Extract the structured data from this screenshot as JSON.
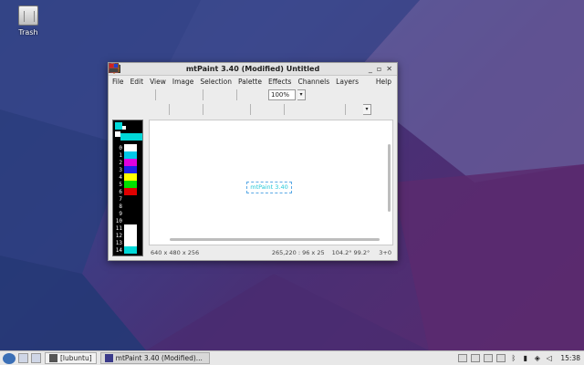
{
  "desktop": {
    "trash_label": "Trash"
  },
  "window": {
    "title": "mtPaint 3.40 (Modified) Untitled",
    "controls": [
      "_",
      "▫",
      "✕"
    ]
  },
  "menu": {
    "items": [
      "File",
      "Edit",
      "View",
      "Image",
      "Selection",
      "Palette",
      "Effects",
      "Channels",
      "Layers"
    ],
    "help": "Help"
  },
  "toolbar": {
    "zoom_value": "100%"
  },
  "palette": {
    "entries": [
      {
        "index": "0",
        "color": "#ffffff"
      },
      {
        "index": "1",
        "color": "#00c8e8"
      },
      {
        "index": "2",
        "color": "#e000e0"
      },
      {
        "index": "3",
        "color": "#2020e8"
      },
      {
        "index": "4",
        "color": "#ffff00"
      },
      {
        "index": "5",
        "color": "#00e000"
      },
      {
        "index": "6",
        "color": "#e00000"
      },
      {
        "index": "7",
        "color": "#000000"
      },
      {
        "index": "8",
        "color": "#000000"
      },
      {
        "index": "9",
        "color": "#000000"
      },
      {
        "index": "10",
        "color": "#000000"
      },
      {
        "index": "11",
        "color": "#ffffff"
      },
      {
        "index": "12",
        "color": "#ffffff"
      },
      {
        "index": "13",
        "color": "#ffffff"
      },
      {
        "index": "14",
        "color": "#00d8d8"
      }
    ]
  },
  "canvas": {
    "selection_text": "mtPaint 3.40"
  },
  "status": {
    "geometry": "640 x 480 x 256",
    "cursor": "265,220 : 96 x 25",
    "angle": "104.2° 99.2°",
    "index": "3+0"
  },
  "taskbar": {
    "folder_label": "[lubuntu]",
    "app_label": "mtPaint 3.40 (Modified)...",
    "clock": "15:38"
  }
}
